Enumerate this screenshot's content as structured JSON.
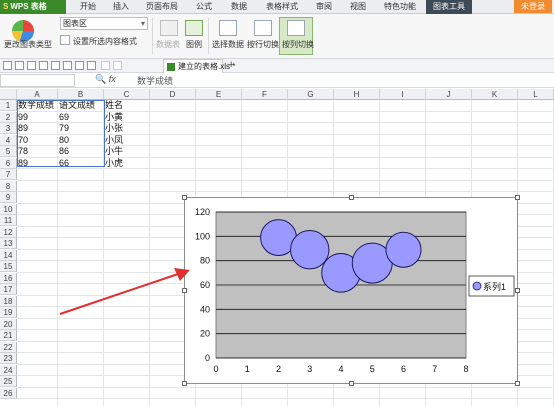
{
  "menubar": {
    "app": "WPS 表格",
    "tabs": [
      "开始",
      "插入",
      "页面布局",
      "公式",
      "数据",
      "表格样式",
      "审阅",
      "视图",
      "特色功能",
      "图表工具"
    ],
    "active_tab": "图表工具",
    "login": "未登录"
  },
  "ribbon": {
    "change_type": "更改图表类型",
    "chart_area": "图表区",
    "set_format": "设置所选内容格式",
    "data_table": "数据表",
    "legend": "图例",
    "select_data": "选择数据",
    "switch_row": "按行切换",
    "switch_col": "按列切换"
  },
  "toolbar": {
    "file_tab": "建立的表格.xls *",
    "plus": "+"
  },
  "formula": {
    "content": "数学成绩"
  },
  "grid": {
    "columns": [
      "A",
      "B",
      "C",
      "D",
      "E",
      "F",
      "G",
      "H",
      "I",
      "J",
      "K",
      "L"
    ],
    "rows": [
      "1",
      "2",
      "3",
      "4",
      "5",
      "6",
      "7",
      "8",
      "9",
      "10",
      "11",
      "12",
      "13",
      "14",
      "15",
      "16",
      "17",
      "18",
      "19",
      "20",
      "21",
      "22",
      "23",
      "24",
      "25",
      "26"
    ],
    "cells": [
      [
        "数学成绩",
        "语文成绩",
        "姓名"
      ],
      [
        "99",
        "69",
        "小黄"
      ],
      [
        "89",
        "79",
        "小张"
      ],
      [
        "70",
        "80",
        "小凤"
      ],
      [
        "78",
        "86",
        "小牛"
      ],
      [
        "89",
        "66",
        "小虎"
      ]
    ]
  },
  "chart_data": {
    "type": "scatter",
    "x": [
      2,
      3,
      4,
      5,
      6
    ],
    "y": [
      99,
      89,
      70,
      78,
      89
    ],
    "sizes": [
      69,
      79,
      80,
      86,
      66
    ],
    "xlim": [
      0,
      8
    ],
    "ylim": [
      0,
      120
    ],
    "xticks": [
      "0",
      "1",
      "2",
      "3",
      "4",
      "5",
      "6",
      "7",
      "8"
    ],
    "yticks": [
      "0",
      "20",
      "40",
      "60",
      "80",
      "100",
      "120"
    ],
    "legend": "系列1",
    "legend_position": "right",
    "plot_bg": "#c0c0c0",
    "bubble_color": "#9999ff"
  },
  "colors": {
    "accent": "#3b8a2a",
    "arrow": "#e03030",
    "selection": "#4a74c4"
  }
}
